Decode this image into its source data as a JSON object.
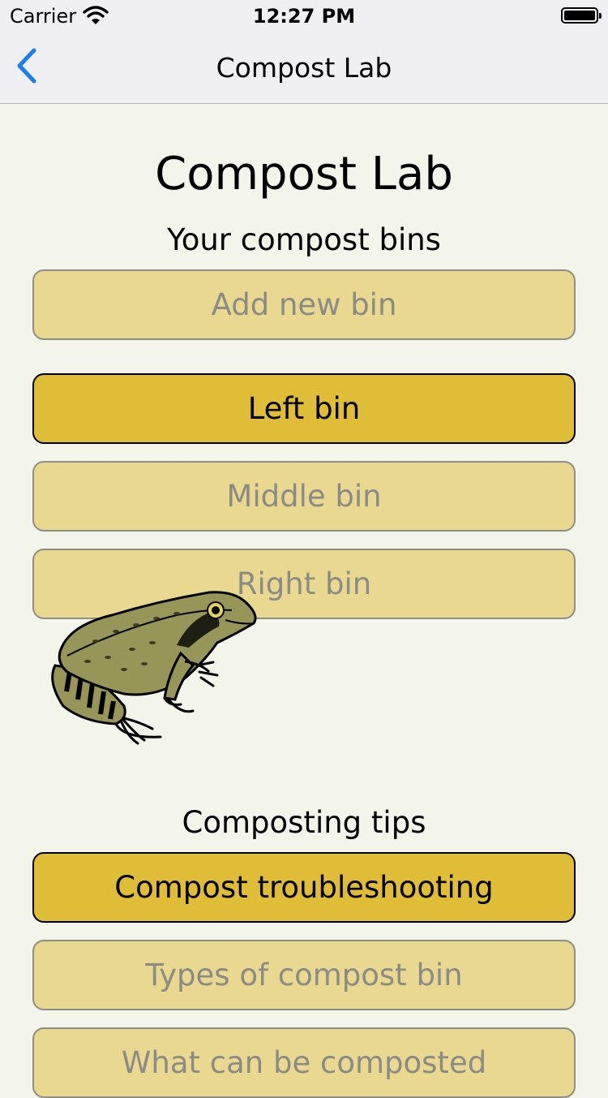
{
  "status_bar": {
    "carrier": "Carrier",
    "time": "12:27 PM",
    "wifi_icon": "wifi-icon",
    "battery_icon": "battery-full-icon"
  },
  "nav": {
    "back_icon": "chevron-left-icon",
    "title": "Compost Lab",
    "accent_color": "#1a7ff2"
  },
  "main": {
    "title": "Compost Lab",
    "bins_heading": "Your compost bins",
    "bins": [
      {
        "label": "Add new bin",
        "selected": false
      },
      {
        "label": "Left bin",
        "selected": true
      },
      {
        "label": "Middle bin",
        "selected": false
      },
      {
        "label": "Right bin",
        "selected": false
      }
    ],
    "tips_heading": "Composting tips",
    "tips": [
      {
        "label": "Compost troubleshooting",
        "selected": true
      },
      {
        "label": "Types of compost bin",
        "selected": false
      },
      {
        "label": "What can be composted",
        "selected": false
      }
    ],
    "illustration": "frog-illustration"
  },
  "colors": {
    "background": "#f3f5ea",
    "button_active": "#e0bd36",
    "button_inactive": "#e9d990",
    "inactive_text": "#8b8b86"
  }
}
